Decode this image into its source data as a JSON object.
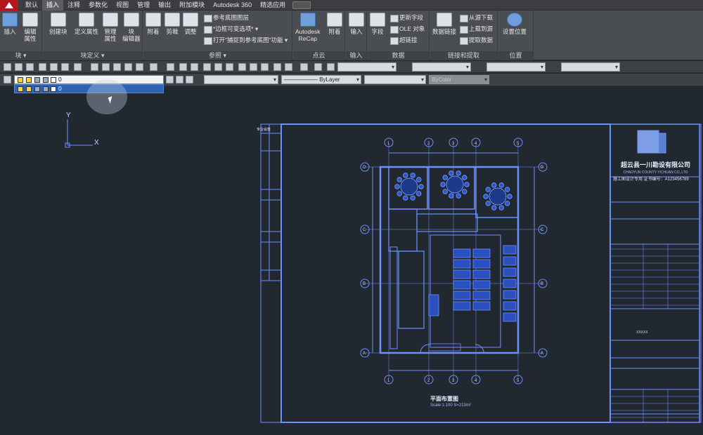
{
  "tabs": [
    "默认",
    "插入",
    "注释",
    "参数化",
    "视图",
    "管理",
    "输出",
    "附加模块",
    "Autodesk 360",
    "精选应用"
  ],
  "active_tab": "插入",
  "ribbon": {
    "block_panel": {
      "title": "块 ▾",
      "buttons": [
        "插入",
        "编辑\n属性"
      ]
    },
    "block_def_panel": {
      "title": "块定义 ▾",
      "buttons": [
        "创建块",
        "定义属性",
        "管理\n属性",
        "块\n编辑器"
      ]
    },
    "reference_panel": {
      "title": "参照 ▾",
      "buttons": [
        "附着",
        "剪裁",
        "调整"
      ],
      "small": [
        "参考底图图层",
        "*边框可变选项* ▾",
        "打开\"捕捉到参考底图\"功能 ▾"
      ]
    },
    "pointcloud_panel": {
      "title": "点云",
      "buttons": [
        "Autodesk\nReCap",
        "附着"
      ]
    },
    "import_panel": {
      "title": "输入",
      "buttons": [
        "输入"
      ]
    },
    "data_panel": {
      "title": "数据",
      "buttons": [
        "字段"
      ],
      "small": [
        "更新字段",
        "OLE 对象",
        "超链接"
      ]
    },
    "link_panel": {
      "title": "链接和提取",
      "buttons": [
        "数据链接"
      ],
      "small": [
        "从源下载",
        "上载到源",
        "提取数据"
      ]
    },
    "location_panel": {
      "title": "位置",
      "buttons": [
        "设置位置"
      ]
    }
  },
  "toolbar2": {
    "layer_value": "0",
    "layer_list_item": "0",
    "linetype": "—————— ByLayer",
    "lineweight_dis": "ByColor"
  },
  "drawing": {
    "title_company": "超云县一川勘设有限公司",
    "title_company_en": "CHAOYUN COUNTY YICHUAN CO.,LTD",
    "title_sub": "施工图设计专用 证书编号：A123456789",
    "plan_title": "平面布置图",
    "plan_scale": "Scale:1:100  S=213m²",
    "side_label": "专业会签",
    "grid_top": [
      "1",
      "2",
      "3",
      "4",
      "5"
    ],
    "grid_left": [
      "D",
      "C",
      "B",
      "A"
    ]
  },
  "colors": {
    "canvas": "#212830",
    "line": "#6d8fff",
    "accent": "#b3161c"
  }
}
